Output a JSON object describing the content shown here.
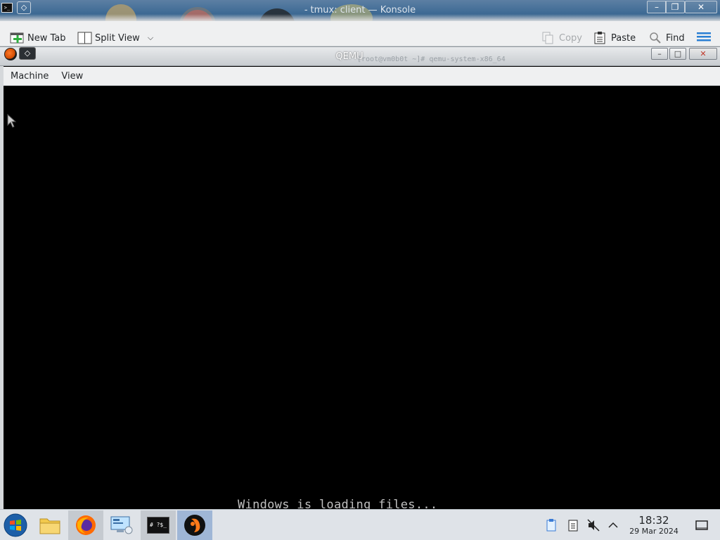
{
  "konsole": {
    "title": "tmux: client — Konsole",
    "title_prefix": "-",
    "app_icon_text": ">_",
    "buttons": {
      "minimize": "–",
      "restore": "❐",
      "close": "✕"
    },
    "toolbar": {
      "new_tab_label": "New Tab",
      "split_view_label": "Split View",
      "copy_label": "Copy",
      "paste_label": "Paste",
      "find_label": "Find"
    }
  },
  "qemu": {
    "title": "QEMU",
    "ghost_command": "[root@vm0b0t ~]# qemu-system-x86_64",
    "menu": {
      "machine": "Machine",
      "view": "View"
    },
    "buttons": {
      "minimize": "–",
      "maximize": "□",
      "close": "✕"
    },
    "screen": {
      "loading_text": "Windows is loading files..."
    }
  },
  "taskbar": {
    "apps": [
      {
        "name": "start-menu",
        "icon": "windows-orb-icon"
      },
      {
        "name": "file-manager",
        "icon": "folder-icon"
      },
      {
        "name": "firefox",
        "icon": "firefox-icon"
      },
      {
        "name": "remote-desktop",
        "icon": "monitor-icon"
      },
      {
        "name": "konsole",
        "icon": "terminal-icon",
        "label": "# ?$_"
      },
      {
        "name": "qemu",
        "icon": "qemu-icon"
      }
    ],
    "clock": {
      "time": "18:32",
      "date": "29 Mar 2024"
    }
  },
  "colors": {
    "titlebar_blue": "#3f6b95",
    "toolbar_bg": "#eff0f1",
    "taskbar_bg": "#dfe3e8",
    "taskbar_focused": "#9fb6d6",
    "screen_bg": "#000000",
    "loading_text": "#c0c0c0"
  }
}
